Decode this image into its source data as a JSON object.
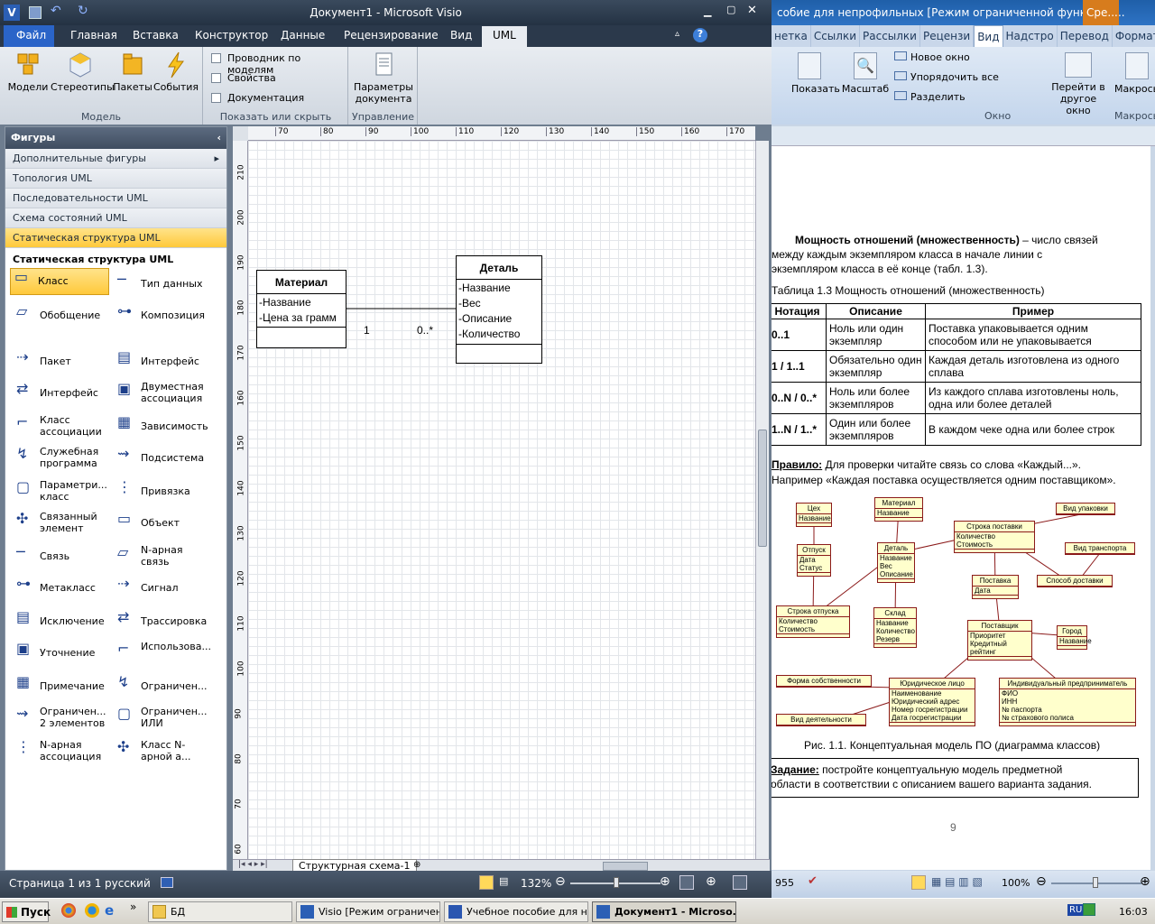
{
  "visio": {
    "title": "Документ1 - Microsoft Visio",
    "tabs": [
      "Файл",
      "Главная",
      "Вставка",
      "Конструктор",
      "Данные",
      "Рецензирование",
      "Вид",
      "UML"
    ],
    "ribbon": {
      "model_group": {
        "label": "Модель",
        "buttons": [
          "Модели",
          "Стереотипы",
          "Пакеты",
          "События"
        ]
      },
      "show_group": {
        "label": "Показать или скрыть",
        "checks": [
          "Проводник по моделям",
          "Свойства",
          "Документация"
        ]
      },
      "manage_group": {
        "label": "Управление",
        "button": "Параметры документа"
      }
    },
    "panel": {
      "title": "Фигуры",
      "stencils": [
        "Дополнительные фигуры",
        "Топология UML",
        "Последовательности UML",
        "Схема состояний UML",
        "Статическая структура UML"
      ],
      "section": "Статическая структура UML",
      "shapes": [
        [
          "Класс",
          "Тип данных"
        ],
        [
          "Обобщение",
          "Композиция"
        ],
        [
          "Пакет",
          "Интерфейс"
        ],
        [
          "Интерфейс",
          "Двуместная ассоциация"
        ],
        [
          "Класс ассоциации",
          "Зависимость"
        ],
        [
          "Служебная программа",
          "Подсистема"
        ],
        [
          "Параметри... класс",
          "Привязка"
        ],
        [
          "Связанный элемент",
          "Объект"
        ],
        [
          "Связь",
          "N-арная связь"
        ],
        [
          "Метакласс",
          "Сигнал"
        ],
        [
          "Исключение",
          "Трассировка"
        ],
        [
          "Уточнение",
          "Использова..."
        ],
        [
          "Примечание",
          "Ограничен..."
        ],
        [
          "Ограничен... 2 элементов",
          "Ограничен... ИЛИ"
        ],
        [
          "N-арная ассоциация",
          "Класс N-арной а..."
        ]
      ]
    },
    "hruler_ticks": [
      "70",
      "80",
      "90",
      "100",
      "110",
      "120",
      "130",
      "140",
      "150",
      "160",
      "170"
    ],
    "vruler_ticks": [
      "210",
      "200",
      "190",
      "180",
      "170",
      "160",
      "150",
      "140",
      "130",
      "120",
      "110",
      "100",
      "90",
      "80",
      "70",
      "60"
    ],
    "diagram": {
      "class1": {
        "name": "Материал",
        "attrs": [
          "-Название",
          "-Цена за грамм"
        ]
      },
      "class2": {
        "name": "Деталь",
        "attrs": [
          "-Название",
          "-Вес",
          "-Описание",
          "-Количество"
        ]
      },
      "mult_left": "1",
      "mult_right": "0..*"
    },
    "page_tab": "Структурная схема-1",
    "status": {
      "page": "Страница 1 из 1",
      "lang": "русский",
      "zoom": "132%"
    }
  },
  "word": {
    "title": "собие для непрофильных [Режим ограниченной функцион...",
    "title_accent": "Сре...",
    "tabs": [
      "нетка",
      "Ссылки",
      "Рассылки",
      "Рецензи",
      "Вид",
      "Надстро",
      "Перевод",
      "Формат"
    ],
    "ribbon": {
      "show": "Показать",
      "scale": "Масштаб",
      "new_window": "Новое окно",
      "arrange": "Упорядочить все",
      "split": "Разделить",
      "switch": "Перейти в другое окно",
      "macros": "Макросы",
      "group_window": "Окно",
      "group_macros": "Макросы"
    },
    "heading_bold": "Мощность отношений (множественность)",
    "heading_rest": " – число связей",
    "p1_l2": "между каждым экземпляром класса в начале линии с",
    "p1_l3": "экземпляром класса в её конце (табл. 1.3).",
    "table_caption": "Таблица 1.3 Мощность отношений (множественность)",
    "table_head": [
      "Нотация",
      "Описание",
      "Пример"
    ],
    "table_rows": [
      [
        "0..1",
        "Ноль или один экземпляр",
        "Поставка упаковывается одним способом или не упаковывается"
      ],
      [
        "1  /  1..1",
        "Обязательно один экземпляр",
        "Каждая деталь изготовлена из одного сплава"
      ],
      [
        "0..N / 0..*",
        "Ноль или более экземпляров",
        "Из каждого сплава изготовлены ноль, одна или более деталей"
      ],
      [
        "1..N / 1..*",
        "Один или более экземпляров",
        "В каждом чеке одна или более строк"
      ]
    ],
    "rule_label": "Правило:",
    "rule_text": " Для проверки читайте связь со слова «Каждый...».",
    "rule_l2": "Например «Каждая поставка осуществляется одним поставщиком».",
    "figure": {
      "boxes": [
        {
          "t": "Цех",
          "a": [
            "Название"
          ]
        },
        {
          "t": "Материал",
          "a": [
            "Название"
          ]
        },
        {
          "t": "Строка поставки",
          "a": [
            "Количество",
            "Стоимость"
          ]
        },
        {
          "t": "Вид упаковки",
          "a": []
        },
        {
          "t": "Отпуск",
          "a": [
            "Дата",
            "Статус"
          ]
        },
        {
          "t": "Деталь",
          "a": [
            "Название",
            "Вес",
            "Описание"
          ]
        },
        {
          "t": "Вид транспорта",
          "a": []
        },
        {
          "t": "Поставка",
          "a": [
            "Дата"
          ]
        },
        {
          "t": "Способ доставки",
          "a": []
        },
        {
          "t": "Строка отпуска",
          "a": [
            "Количество",
            "Стоимость"
          ]
        },
        {
          "t": "Склад",
          "a": [
            "Название",
            "Количество",
            "Резерв"
          ]
        },
        {
          "t": "Поставщик",
          "a": [
            "Приоритет",
            "Кредитный рейтинг"
          ]
        },
        {
          "t": "Город",
          "a": [
            "Название"
          ]
        },
        {
          "t": "Форма собственности",
          "a": []
        },
        {
          "t": "Юридическое лицо",
          "a": [
            "Наименование",
            "Юридический адрес",
            "Номер госрегистрации",
            "Дата госрегистрации"
          ]
        },
        {
          "t": "Индивидуальный предприниматель",
          "a": [
            "ФИО",
            "ИНН",
            "№ паспорта",
            "№ страхового полиса"
          ]
        },
        {
          "t": "Вид деятельности",
          "a": []
        }
      ],
      "caption": "Рис. 1.1. Концептуальная модель ПО (диаграмма классов)"
    },
    "task_label": "Задание:",
    "task_text": " постройте концептуальную модель предметной",
    "task_l2": "области в соответствии с описанием вашего варианта задания.",
    "page_number": "9",
    "status": {
      "words": "955",
      "zoom": "100%"
    }
  },
  "taskbar": {
    "start": "Пуск",
    "items": [
      "БД",
      "Visio [Режим ограничен...",
      "Учебное пособие для н...",
      "Документ1 - Microso..."
    ],
    "lang": "RU",
    "clock": "16:03"
  }
}
